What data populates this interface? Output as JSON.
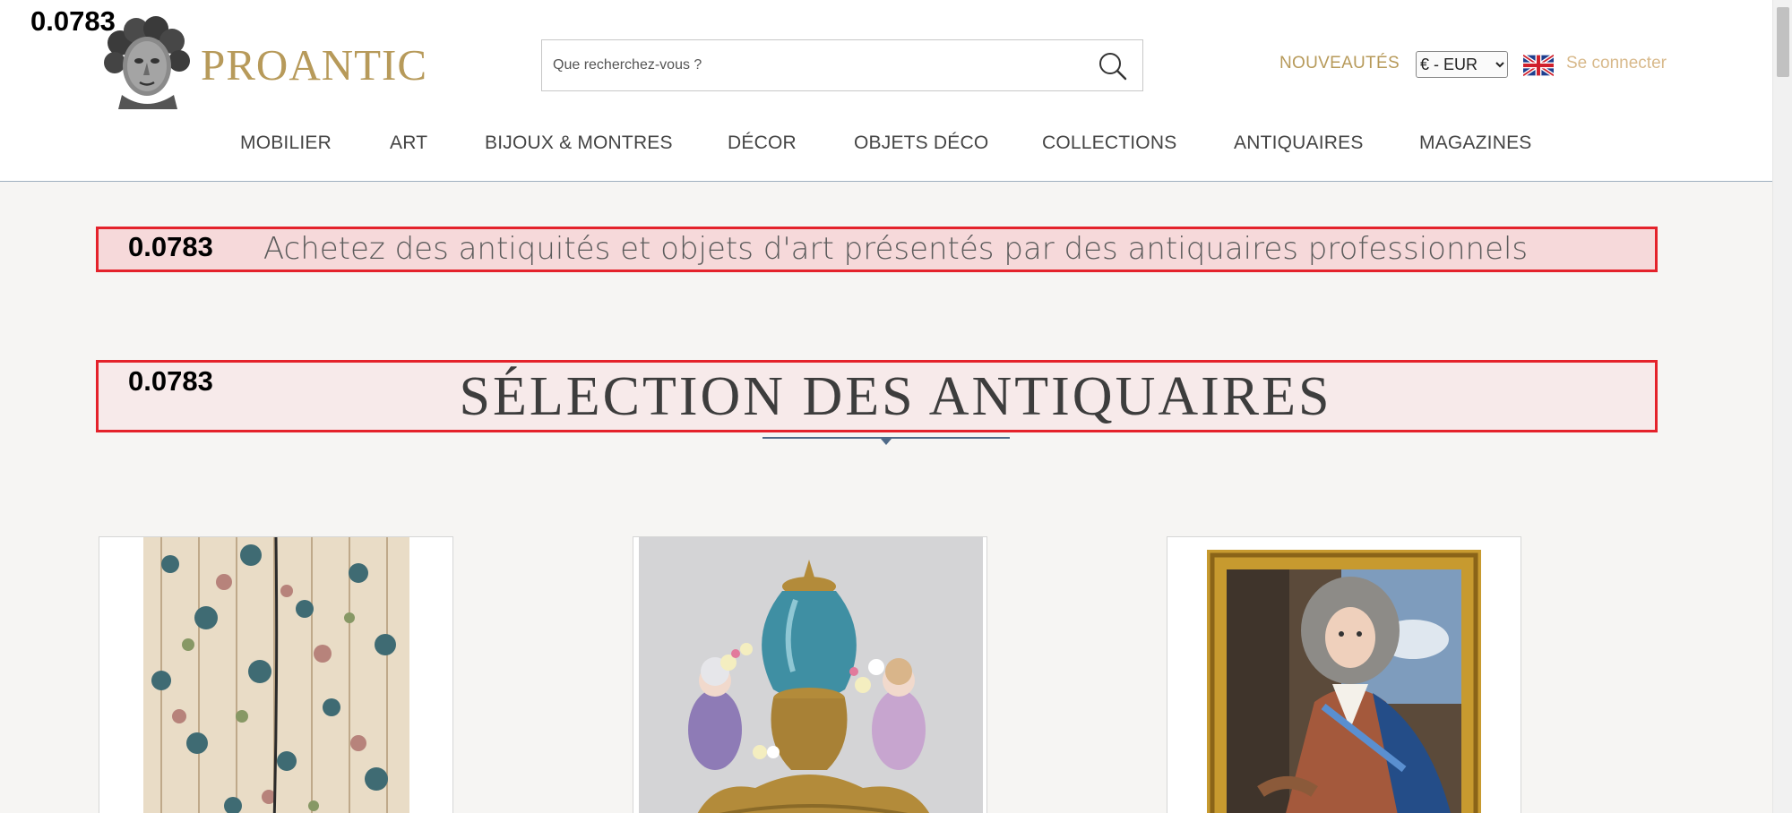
{
  "scores": {
    "corner": "0.0783",
    "tagline": "0.0783",
    "section": "0.0783"
  },
  "header": {
    "logo_text": "PROANTIC",
    "search_placeholder": "Que recherchez-vous ?",
    "nouveautes": "NOUVEAUTÉS",
    "currency_selected": "€ - EUR",
    "language_flag": "uk-flag-icon",
    "connect": "Se connecter",
    "accent_color": "#b79a5a"
  },
  "nav": {
    "items": [
      "MOBILIER",
      "ART",
      "BIJOUX & MONTRES",
      "DÉCOR",
      "OBJETS DÉCO",
      "COLLECTIONS",
      "ANTIQUAIRES",
      "MAGAZINES"
    ]
  },
  "main": {
    "tagline": "Achetez des antiquités et objets d'art présentés par des antiquaires professionnels",
    "section_title": "SÉLECTION DES ANTIQUAIRES",
    "highlight_color": "#e4222b"
  },
  "products": [
    {
      "image": "floral-curtain-image"
    },
    {
      "image": "porcelain-urn-image"
    },
    {
      "image": "portrait-painting-image"
    }
  ]
}
